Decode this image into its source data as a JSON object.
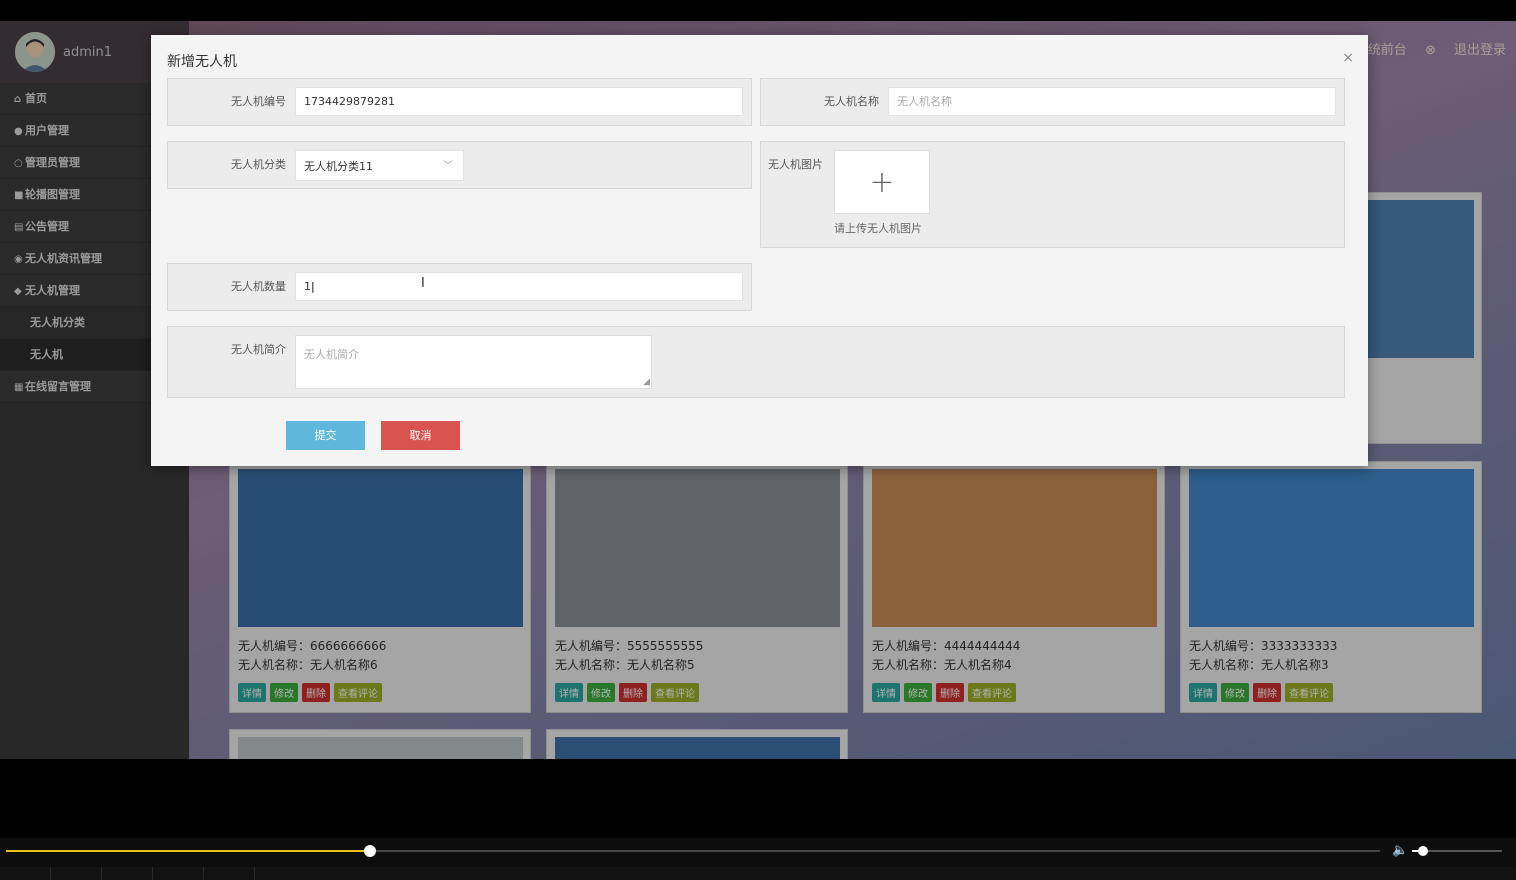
{
  "header": {
    "username": "admin1",
    "front_link": "系统前台",
    "logout": "退出登录"
  },
  "sidebar": {
    "items": [
      {
        "icon": "home-icon",
        "glyph": "⌂",
        "label": "首页"
      },
      {
        "icon": "user-icon",
        "glyph": "●",
        "label": "用户管理"
      },
      {
        "icon": "admin-icon",
        "glyph": "○",
        "label": "管理员管理"
      },
      {
        "icon": "carousel-icon",
        "glyph": "■",
        "label": "轮播图管理"
      },
      {
        "icon": "notice-icon",
        "glyph": "▤",
        "label": "公告管理"
      },
      {
        "icon": "news-icon",
        "glyph": "◉",
        "label": "无人机资讯管理"
      },
      {
        "icon": "drone-icon",
        "glyph": "◆",
        "label": "无人机管理"
      },
      {
        "icon": "",
        "glyph": "",
        "label": "无人机分类"
      },
      {
        "icon": "",
        "glyph": "",
        "label": "无人机"
      },
      {
        "icon": "message-icon",
        "glyph": "▦",
        "label": "在线留言管理"
      }
    ]
  },
  "cards": [
    {
      "code_label": "无人机编号：",
      "code": "6666666666",
      "name_label": "无人机名称：",
      "name": "无人机名称6"
    },
    {
      "code_label": "无人机编号：",
      "code": "5555555555",
      "name_label": "无人机名称：",
      "name": "无人机名称5"
    },
    {
      "code_label": "无人机编号：",
      "code": "4444444444",
      "name_label": "无人机名称：",
      "name": "无人机名称4"
    },
    {
      "code_label": "无人机编号：",
      "code": "3333333333",
      "name_label": "无人机名称：",
      "name": "无人机名称3"
    }
  ],
  "card_buttons": {
    "detail": "详情",
    "edit": "修改",
    "delete": "删除",
    "comments": "查看评论"
  },
  "modal": {
    "title": "新增无人机",
    "close": "×",
    "code_label": "无人机编号",
    "code_value": "1734429879281",
    "name_label": "无人机名称",
    "name_placeholder": "无人机名称",
    "category_label": "无人机分类",
    "category_value": "无人机分类11",
    "image_label": "无人机图片",
    "upload_plus": "+",
    "upload_tip": "请上传无人机图片",
    "quantity_label": "无人机数量",
    "quantity_value": "1",
    "intro_label": "无人机简介",
    "intro_placeholder": "无人机简介",
    "submit": "提交",
    "cancel": "取消"
  },
  "player": {
    "progress": 0.265,
    "volume": 0.12
  },
  "colors": {
    "accent_progress": "#e8c21a",
    "submit": "#5fb8dc",
    "cancel": "#d9534f"
  }
}
